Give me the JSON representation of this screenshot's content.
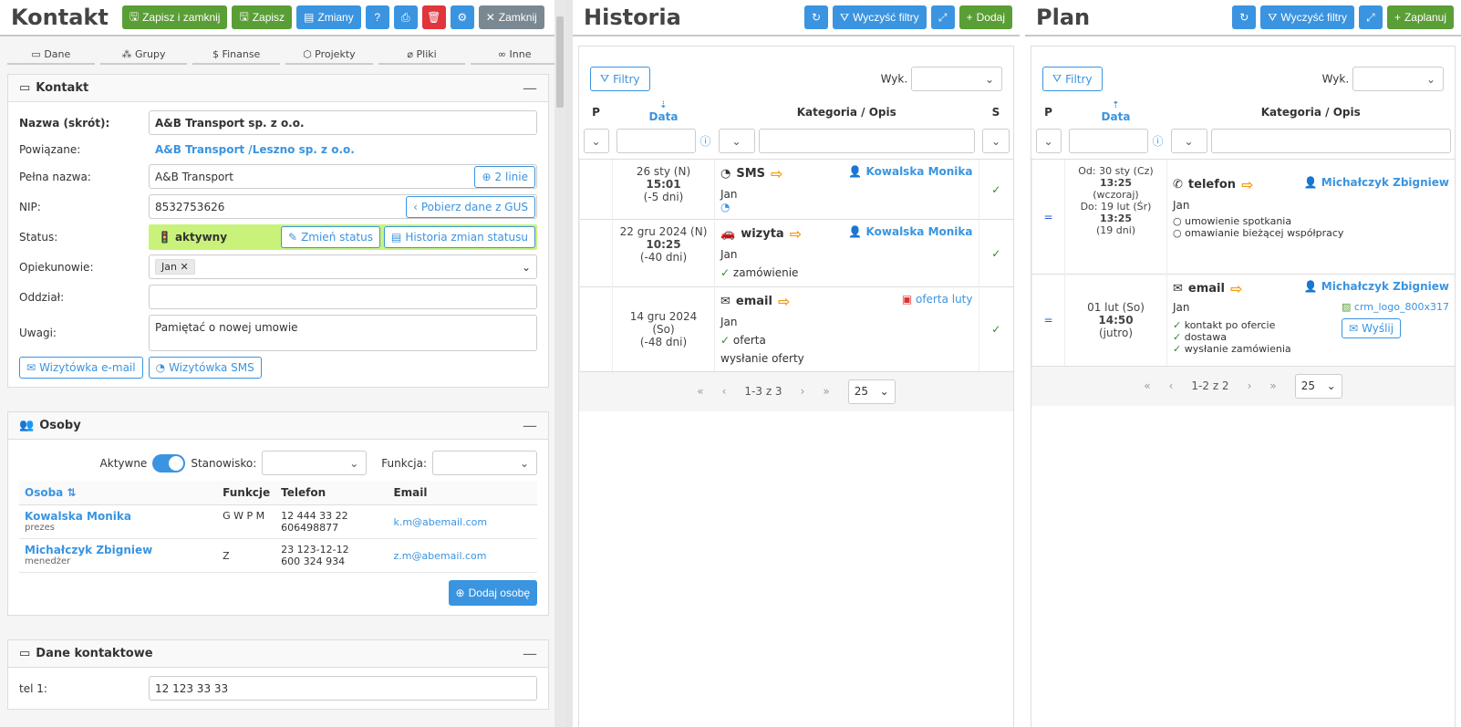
{
  "kontakt": {
    "title": "Kontakt",
    "buttons": {
      "save_close": "Zapisz i zamknij",
      "save": "Zapisz",
      "changes": "Zmiany",
      "close": "Zamknij"
    },
    "tabs": [
      "Dane",
      "Grupy",
      "Finanse",
      "Projekty",
      "Pliki",
      "Inne"
    ],
    "section_title": "Kontakt",
    "fields": {
      "nazwa_label": "Nazwa (skrót):",
      "nazwa_value": "A&B Transport sp. z o.o.",
      "powiazane_label": "Powiązane:",
      "powiazane_value": "A&B Transport /Leszno sp. z o.o.",
      "pelna_label": "Pełna nazwa:",
      "pelna_value": "A&B Transport",
      "pelna_btn": "2 linie",
      "nip_label": "NIP:",
      "nip_value": "8532753626",
      "nip_btn": "Pobierz dane z GUS",
      "status_label": "Status:",
      "status_value": "aktywny",
      "status_btn1": "Zmień status",
      "status_btn2": "Historia zmian statusu",
      "opiek_label": "Opiekunowie:",
      "opiek_value": "Jan",
      "oddzial_label": "Oddział:",
      "oddzial_value": "",
      "uwagi_label": "Uwagi:",
      "uwagi_value": "Pamiętać o nowej umowie"
    },
    "card_email": "Wizytówka e-mail",
    "card_sms": "Wizytówka SMS",
    "osoby": {
      "title": "Osoby",
      "aktywne": "Aktywne",
      "stanowisko": "Stanowisko:",
      "funkcja": "Funkcja:",
      "headers": [
        "Osoba",
        "Funkcje",
        "Telefon",
        "Email"
      ],
      "rows": [
        {
          "name": "Kowalska Monika",
          "role": "prezes",
          "funkcje": "G W P M",
          "tel1": "12 444 33 22",
          "tel2": "606498877",
          "email": "k.m@abemail.com"
        },
        {
          "name": "Michałczyk Zbigniew",
          "role": "menedżer",
          "funkcje": "Z",
          "tel1": "23 123-12-12",
          "tel2": "600 324 934",
          "email": "z.m@abemail.com"
        }
      ],
      "add": "Dodaj osobę"
    },
    "dane_kontaktowe": {
      "title": "Dane kontaktowe",
      "tel_label": "tel 1:",
      "tel_value": "12 123 33 33"
    }
  },
  "historia": {
    "title": "Historia",
    "clear": "Wyczyść filtry",
    "add": "Dodaj",
    "filters": "Filtry",
    "wyk": "Wyk.",
    "headers": {
      "p": "P",
      "data": "Data",
      "kat": "Kategoria / Opis",
      "s": "S"
    },
    "rows": [
      {
        "date": "26 sty (N)",
        "time": "15:01",
        "rel": "(-5 dni)",
        "cat": "SMS",
        "who": "Jan",
        "person": "Kowalska Monika",
        "extra": []
      },
      {
        "date": "22 gru 2024 (N)",
        "time": "10:25",
        "rel": "(-40 dni)",
        "cat": "wizyta",
        "who": "Jan",
        "person": "Kowalska Monika",
        "extra": [
          "zamówienie"
        ]
      },
      {
        "date": "14 gru 2024 (So)",
        "time": "",
        "rel": "(-48 dni)",
        "cat": "email",
        "who": "Jan",
        "person": "oferta luty",
        "extra": [
          "oferta"
        ],
        "note": "wysłanie oferty"
      }
    ],
    "pager": "1-3 z 3",
    "pagesize": "25"
  },
  "plan": {
    "title": "Plan",
    "clear": "Wyczyść filtry",
    "add": "Zaplanuj",
    "filters": "Filtry",
    "wyk": "Wyk.",
    "headers": {
      "p": "P",
      "data": "Data",
      "kat": "Kategoria / Opis"
    },
    "rows": [
      {
        "od_label": "Od:",
        "od": "30 sty (Cz)",
        "od_time": "13:25",
        "od_rel": "(wczoraj)",
        "do_label": "Do:",
        "do": "19 lut (Śr)",
        "do_time": "13:25",
        "do_rel": "(19 dni)",
        "cat": "telefon",
        "who": "Jan",
        "person": "Michałczyk Zbigniew",
        "tasks": [
          "umowienie spotkania",
          "omawianie bieżącej współpracy"
        ]
      },
      {
        "date": "01 lut (So)",
        "time": "14:50",
        "rel": "(jutro)",
        "cat": "email",
        "who": "Jan",
        "person": "Michałczyk Zbigniew",
        "file": "crm_logo_800x317",
        "send": "Wyślij",
        "tasks": [
          "kontakt po ofercie",
          "dostawa",
          "wysłanie zamówienia"
        ]
      }
    ],
    "pager": "1-2 z 2",
    "pagesize": "25"
  }
}
